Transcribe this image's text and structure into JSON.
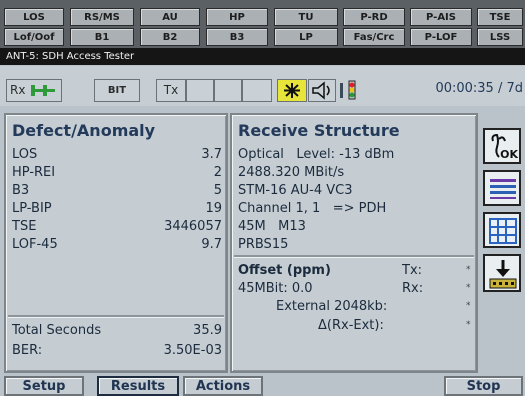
{
  "led_row1": [
    "LOS",
    "RS/MS",
    "AU",
    "HP",
    "TU",
    "P-RD",
    "P-AIS",
    "TSE"
  ],
  "led_row2": [
    "Lof/Oof",
    "B1",
    "B2",
    "B3",
    "LP",
    "Fas/Crc",
    "P-LOF",
    "LSS"
  ],
  "window_title": "ANT-5: SDH Access Tester",
  "toolbar": {
    "rx": "Rx",
    "bit": "BIT",
    "tx": "Tx",
    "clock": "00:00:35 / 7d"
  },
  "defects": {
    "title": "Defect/Anomaly",
    "rows": [
      {
        "label": "LOS",
        "value": "3.7"
      },
      {
        "label": "HP-REI",
        "value": "2"
      },
      {
        "label": "B3",
        "value": "5"
      },
      {
        "label": "LP-BIP",
        "value": "19"
      },
      {
        "label": "TSE",
        "value": "3446057"
      },
      {
        "label": "LOF-45",
        "value": "9.7"
      }
    ],
    "total_label": "Total Seconds",
    "total_value": "35.9",
    "ber_label": "BER:",
    "ber_value": "3.50E-03"
  },
  "receive": {
    "title": "Receive Structure",
    "lines": [
      "Optical   Level: -13 dBm",
      "2488.320 MBit/s",
      "STM-16 AU-4 VC3",
      "Channel 1, 1   => PDH",
      "45M   M13",
      "PRBS15"
    ]
  },
  "offset": {
    "title": "Offset (ppm)",
    "tx_label": "Tx:",
    "rate": "45MBit: 0.0",
    "rx_label": "Rx:",
    "external": "External 2048kb:",
    "delta": "Δ(Rx-Ext):",
    "star": "*"
  },
  "side_buttons": {
    "ok_label": "OK"
  },
  "bottom": {
    "setup": "Setup",
    "results": "Results",
    "actions": "Actions",
    "stop": "Stop"
  }
}
